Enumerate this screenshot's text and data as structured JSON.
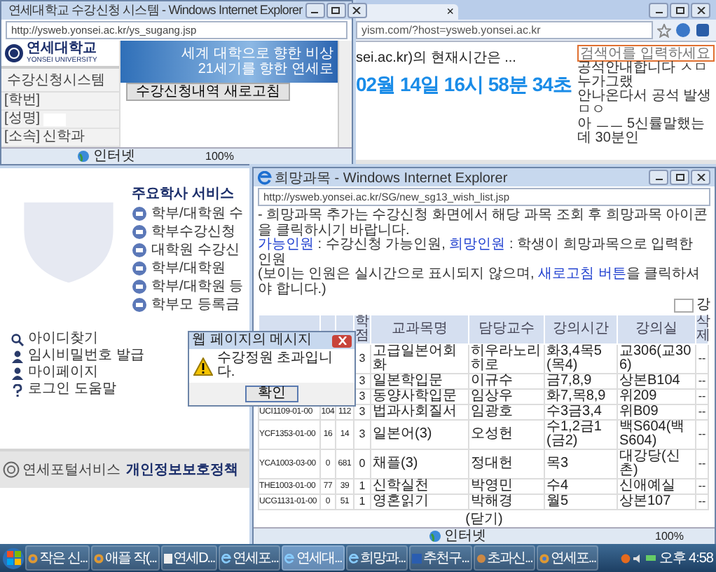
{
  "background_browser": {
    "tab_close": "×",
    "address": "yism.com/?host=ysweb.yonsei.ac.kr",
    "heading": "sei.ac.kr)의 현재시간은 ...",
    "clock": "02월 14일 16시 58분 34초",
    "search": {
      "placeholder": "검색어를 입력하세요"
    },
    "side_items": [
      "공석안내합니다 ㅅㅁ",
      "누가그랬",
      "안나온다서 공석 발생",
      "ㅁㅇ",
      "아 ㅡㅡ 5신률말했는데 30분인"
    ],
    "services_title": "주요학사 서비스",
    "services": [
      "학부/대학원 수",
      "학부수강신청",
      "대학원 수강신",
      "학부/대학원",
      "학부/대학원 등",
      "학부모 등록금"
    ],
    "links": [
      {
        "kind": "search",
        "label": "아이디찾기"
      },
      {
        "kind": "person",
        "label": "임시비밀번호 발급"
      },
      {
        "kind": "person",
        "label": "마이페이지"
      },
      {
        "kind": "help",
        "label": "로그인 도움말"
      }
    ],
    "footer": {
      "logo": "연세포털서비스",
      "policy": "개인정보보호정책"
    }
  },
  "course_window": {
    "title": "연세대학교 수강신청 시스템 - Windows Internet Explorer",
    "address": "http://ysweb.yonsei.ac.kr/ys_sugang.jsp",
    "logo": "연세대학교",
    "logo_sub": "YONSEI UNIVERSITY",
    "banner": [
      "세계 대학으로 향한 비상",
      "21세기를 향한 연세로"
    ],
    "refresh_button": "수강신청내역 새로고침",
    "system_title": "수강신청시스템",
    "fields": [
      {
        "label": "[학번]",
        "redacted": false
      },
      {
        "label": "[성명]",
        "redacted": true
      },
      {
        "label": "[소속]",
        "value": "신학과",
        "redacted": false
      }
    ],
    "status": "인터넷",
    "zoom": "100%"
  },
  "wish_window": {
    "title": "희망과목 - Windows Internet Explorer",
    "address": "http://ysweb.yonsei.ac.kr/SG/new_sg13_wish_list.jsp",
    "notes": [
      [
        {
          "text": "- 희망과목 추가는 수강신청 화면에서 해당 과목 조회 후 희망과목 아이콘을 클릭하시기 바랍니다.",
          "link": false
        }
      ],
      [
        {
          "text": "가능인원",
          "link": true
        },
        {
          "text": " : 수강신청 가능인원, ",
          "link": false
        },
        {
          "text": "희망인원",
          "link": true
        },
        {
          "text": " : 학생이 희망과목으로 입력한 인원",
          "link": false
        }
      ],
      [
        {
          "text": "(보이는 인원은 실시간으로 표시되지 않으며, ",
          "link": false
        },
        {
          "text": "새로고침 버튼",
          "link": true
        },
        {
          "text": "을 클릭하셔야 합니다.)",
          "link": false
        }
      ]
    ],
    "count_unit": "강",
    "columns": [
      "학점",
      "교과목명",
      "담당교수",
      "강의시간",
      "강의실",
      "삭제"
    ],
    "rows": [
      {
        "credit": "3",
        "name": "고급일본어회화",
        "professor": "히우라노리히로",
        "time": "화3,4목5(목4)",
        "room": "교306(교306)",
        "delete": "--"
      },
      {
        "credit": "3",
        "name": "일본학입문",
        "professor": "이규수",
        "time": "금7,8,9",
        "room": "상본B104",
        "delete": "--"
      },
      {
        "credit": "3",
        "name": "동양사학입문",
        "professor": "임상우",
        "time": "화7,목8,9",
        "room": "위209",
        "delete": "--"
      },
      {
        "code": "UCI1109-01-00",
        "n1": "104",
        "n2": "112",
        "credit": "3",
        "name": "법과사회질서",
        "professor": "임광호",
        "time": "수3금3,4",
        "room": "위B09",
        "delete": "--"
      },
      {
        "code": "YCF1353-01-00",
        "n1": "16",
        "n2": "14",
        "credit": "3",
        "name": "일본어(3)",
        "professor": "오성헌",
        "time": "수1,2금1(금2)",
        "room": "백S604(백S604)",
        "delete": "--"
      },
      {
        "code": "YCA1003-03-00",
        "n1": "0",
        "n2": "681",
        "credit": "0",
        "name": "채플(3)",
        "professor": "정대헌",
        "time": "목3",
        "room": "대강당(신촌)",
        "delete": "--"
      },
      {
        "code": "THE1003-01-00",
        "n1": "77",
        "n2": "39",
        "credit": "1",
        "name": "신학실천",
        "professor": "박영민",
        "time": "수4",
        "room": "신애예실",
        "delete": "--"
      },
      {
        "code": "UCG1131-01-00",
        "n1": "0",
        "n2": "51",
        "credit": "1",
        "name": "영혼읽기",
        "professor": "박해경",
        "time": "월5",
        "room": "상본107",
        "delete": "--"
      }
    ],
    "close": "(닫기)",
    "status": "인터넷",
    "zoom": "100%"
  },
  "dialog": {
    "title": "웹 페이지의 메시지",
    "message": "수강정원 초과입니다.",
    "button": "확인"
  },
  "taskbar": {
    "items": [
      {
        "kind": "chrome",
        "label": "작은 신...",
        "selected": false
      },
      {
        "kind": "chrome",
        "label": "애플 작(...",
        "selected": false
      },
      {
        "kind": "doc",
        "label": "연세D...",
        "selected": false
      },
      {
        "kind": "ie",
        "label": "연세포...",
        "selected": false
      },
      {
        "kind": "ie",
        "label": "연세대...",
        "selected": true
      },
      {
        "kind": "ie",
        "label": "희망과...",
        "selected": false
      },
      {
        "kind": "word",
        "label": "추천구...",
        "selected": false
      },
      {
        "kind": "app",
        "label": "초과신...",
        "selected": false
      },
      {
        "kind": "chrome",
        "label": "연세포...",
        "selected": false
      }
    ],
    "clock": "오후 4:58"
  }
}
